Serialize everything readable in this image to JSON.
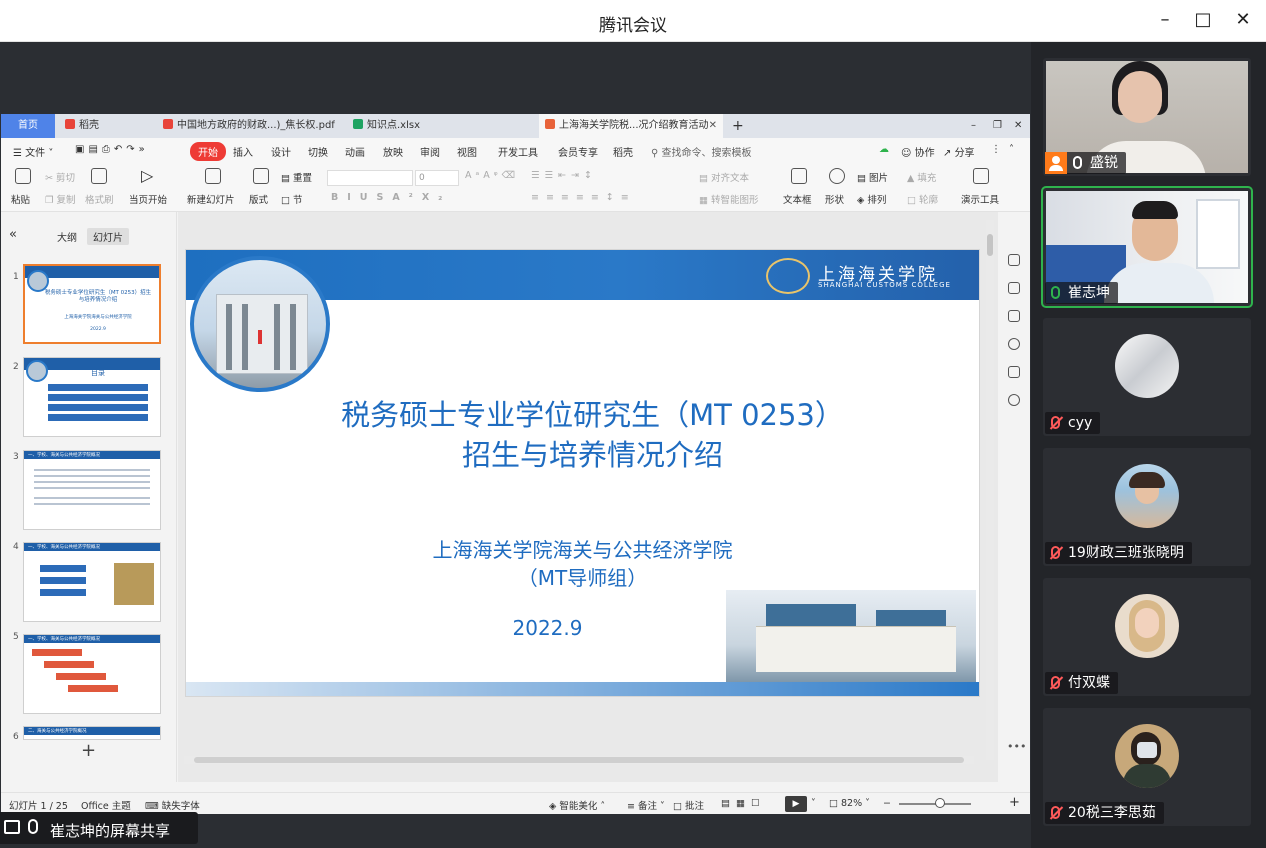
{
  "window": {
    "title": "腾讯会议"
  },
  "wps": {
    "tabs": [
      {
        "label": "首页",
        "type": "home"
      },
      {
        "label": "稻壳",
        "icon_color": "#e8443a"
      },
      {
        "label": "中国地方政府的财政...)_焦长权.pdf",
        "icon_color": "#e8443a"
      },
      {
        "label": "知识点.xlsx",
        "icon_color": "#1ea362"
      },
      {
        "label": "上海海关学院税...况介绍教育活动",
        "icon_color": "#e8633a",
        "active": true
      }
    ],
    "menu": {
      "file": "文件",
      "items": [
        "开始",
        "插入",
        "设计",
        "切换",
        "动画",
        "放映",
        "审阅",
        "视图",
        "开发工具",
        "会员专享",
        "稻壳"
      ],
      "search": "查找命令、搜索模板",
      "collab": "协作",
      "share": "分享"
    },
    "ribbon": {
      "paste": "粘贴",
      "cut": "剪切",
      "copy": "复制",
      "format_painter": "格式刷",
      "from_current": "当页开始",
      "new_slide": "新建幻灯片",
      "layout": "版式",
      "section": "节",
      "reset": "重置",
      "font_size": "0",
      "align_text": "对齐文本",
      "to_smartart": "转智能图形",
      "textbox": "文本框",
      "shape": "形状",
      "picture": "图片",
      "fill": "填充",
      "arrange": "排列",
      "outline": "轮廓",
      "present_tools": "演示工具"
    },
    "panel": {
      "tab_outline": "大纲",
      "tab_slides": "幻灯片"
    },
    "thumbs": [
      {
        "num": "1",
        "title": "税务硕士专业学位研究生（MT 0253）招生与培养情况介绍",
        "sub": "上海海关学院海关与公共经济学院",
        "date": "2022.9"
      },
      {
        "num": "2",
        "title": "目录"
      },
      {
        "num": "3",
        "title": "一、学校、海关与公共经济学院概况"
      },
      {
        "num": "4",
        "title": "一、学校、海关与公共经济学院概况"
      },
      {
        "num": "5",
        "title": "一、学校、海关与公共经济学院概况"
      },
      {
        "num": "6",
        "title": "二、海关与公共经济学院概况"
      }
    ],
    "slide": {
      "college_cn": "上海海关学院",
      "college_en": "SHANGHAI CUSTOMS COLLEGE",
      "title_line1": "税务硕士专业学位研究生（MT 0253）",
      "title_line2": "招生与培养情况介绍",
      "org_line1": "上海海关学院海关与公共经济学院",
      "org_line2": "（MT导师组）",
      "date": "2022.9"
    },
    "status": {
      "slide_counter": "幻灯片 1 / 25",
      "theme": "Office 主题",
      "missing_font": "缺失字体",
      "smart_beautify": "智能美化",
      "notes": "备注",
      "comments": "批注",
      "zoom": "82%"
    }
  },
  "share_banner": {
    "text": "崔志坤的屏幕共享"
  },
  "participants": [
    {
      "name": "盛锐",
      "host": true,
      "muted": false,
      "video": true
    },
    {
      "name": "崔志坤",
      "host": false,
      "muted": false,
      "video": true,
      "speaking": true
    },
    {
      "name": "cyy",
      "muted": true,
      "video": false
    },
    {
      "name": "19财政三班张晓明",
      "muted": true,
      "video": false
    },
    {
      "name": "付双蝶",
      "muted": true,
      "video": false
    },
    {
      "name": "20税三李思茹",
      "muted": true,
      "video": false
    }
  ],
  "colors": {
    "accent": "#4f83e8",
    "start_tab": "#ee3b35",
    "slide_blue": "#1f6cc0",
    "speaking": "#2fb34d",
    "muted": "#ff5a5a",
    "host": "#ff7b1a"
  },
  "icons": [
    "minimize-icon",
    "maximize-icon",
    "close-icon",
    "screen-share-icon",
    "mic-icon",
    "mic-muted-icon",
    "host-icon",
    "play-icon",
    "search-icon",
    "add-icon"
  ]
}
